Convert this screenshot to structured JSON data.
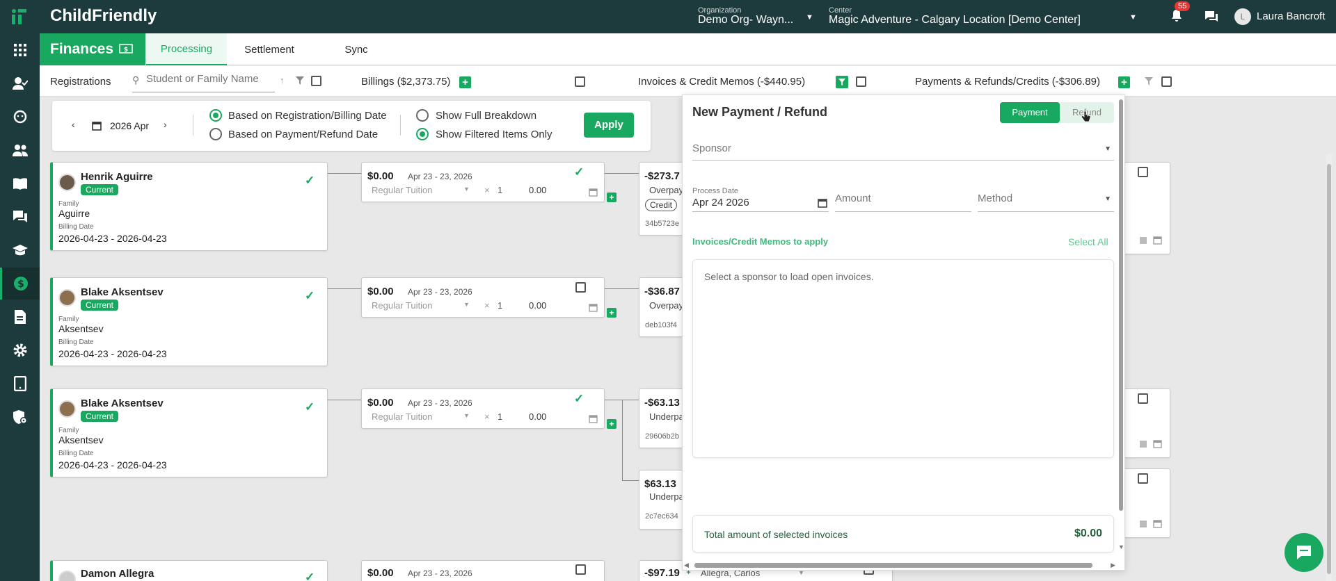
{
  "header": {
    "logo": "ChildFriendly",
    "org_label": "Organization",
    "org_value": "Demo Org- Wayn...",
    "center_label": "Center",
    "center_value": "Magic Adventure - Calgary Location [Demo Center]",
    "notif_count": "55",
    "user_initial": "L",
    "user_name": "Laura Bancroft"
  },
  "sidebar": {
    "items": [
      "apps-icon",
      "person-check-icon",
      "child-face-icon",
      "people-icon",
      "book-icon",
      "chat-icon",
      "graduation-icon",
      "dollar-icon",
      "document-icon",
      "gear-icon",
      "tablet-icon",
      "shield-gear-icon"
    ],
    "active_index": 7
  },
  "subnav": {
    "title": "Finances",
    "tabs": [
      "Processing",
      "Settlement",
      "Sync"
    ],
    "active_tab": "Processing"
  },
  "filterbar": {
    "registrations": "Registrations",
    "search_placeholder": "Student or Family Name",
    "billings": "Billings ($2,373.75)",
    "invoices": "Invoices & Credit Memos (-$440.95)",
    "payments": "Payments & Refunds/Credits (-$306.89)"
  },
  "datebox": {
    "month": "2026 Apr",
    "opt1": "Based on Registration/Billing Date",
    "opt2": "Based on Payment/Refund Date",
    "opt3": "Show Full Breakdown",
    "opt4": "Show Filtered Items Only",
    "apply": "Apply"
  },
  "labels": {
    "current": "Current",
    "family": "Family",
    "billing_date": "Billing Date",
    "credit": "Credit"
  },
  "registrations": [
    {
      "name": "Henrik Aguirre",
      "family": "Aguirre",
      "dates": "2026-04-23 - 2026-04-23"
    },
    {
      "name": "Blake Aksentsev",
      "family": "Aksentsev",
      "dates": "2026-04-23 - 2026-04-23"
    },
    {
      "name": "Blake Aksentsev",
      "family": "Aksentsev",
      "dates": "2026-04-23 - 2026-04-23"
    },
    {
      "name": "Damon Allegra",
      "family": "",
      "dates": ""
    }
  ],
  "billings": [
    {
      "amount": "$0.00",
      "range": "Apr 23 - 23, 2026",
      "item": "Regular Tuition",
      "qty": "1",
      "total": "0.00"
    },
    {
      "amount": "$0.00",
      "range": "Apr 23 - 23, 2026",
      "item": "Regular Tuition",
      "qty": "1",
      "total": "0.00"
    },
    {
      "amount": "$0.00",
      "range": "Apr 23 - 23, 2026",
      "item": "Regular Tuition",
      "qty": "1",
      "total": "0.00"
    },
    {
      "amount": "$0.00",
      "range": "Apr 23 - 23, 2026",
      "item": "",
      "qty": "",
      "total": ""
    }
  ],
  "invoices": [
    {
      "amount": "-$273.7",
      "type": "Overpay",
      "id": "34b5723e"
    },
    {
      "amount": "-$36.87",
      "type": "Overpay",
      "id": "deb103f4"
    },
    {
      "amount": "-$63.13",
      "type": "Underpa",
      "id": "29606b2b"
    },
    {
      "amount": "$63.13",
      "type": "Underpa",
      "id": "2c7ec634"
    },
    {
      "amount": "-$97.19",
      "type": "",
      "id": ""
    }
  ],
  "bottom_sponsor": "Allegra, Carlos",
  "panel": {
    "title": "New Payment / Refund",
    "payment_btn": "Payment",
    "refund_btn": "Refund",
    "sponsor_label": "Sponsor",
    "process_date_label": "Process Date",
    "process_date_value": "Apr 24 2026",
    "amount_label": "Amount",
    "method_label": "Method",
    "invoices_label": "Invoices/Credit Memos to apply",
    "select_all": "Select All",
    "empty_msg": "Select a sponsor to load open invoices.",
    "total_label": "Total amount of selected invoices",
    "total_value": "$0.00"
  },
  "colors": {
    "brand": "#19a85f",
    "dark": "#1d3b3d",
    "badge": "#e53935"
  }
}
